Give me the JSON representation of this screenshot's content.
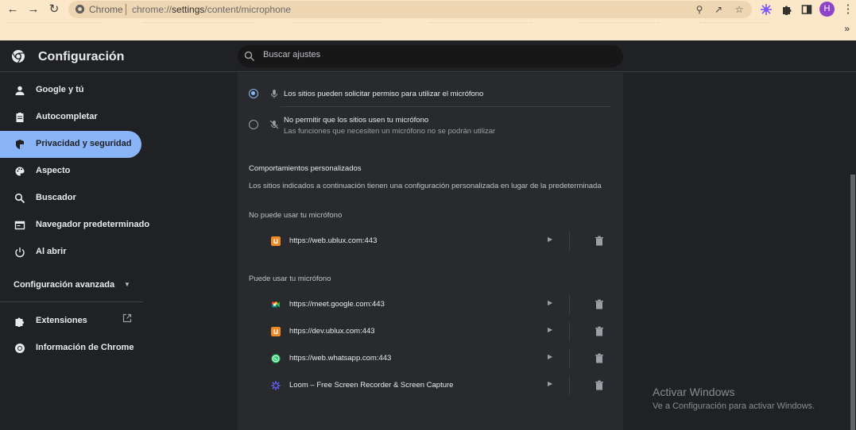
{
  "browser": {
    "site_label": "Chrome",
    "url_prefix": "chrome://",
    "url_host": "settings",
    "url_path": "/content/microphone",
    "profile_initial": "H",
    "icons": [
      "back-icon",
      "forward-icon",
      "reload-icon",
      "info-icon",
      "zoom-icon",
      "share-icon",
      "star-icon",
      "extension-icon",
      "puzzle-icon",
      "side-panel-icon",
      "menu-icon"
    ]
  },
  "header": {
    "title": "Configuración",
    "search_placeholder": "Buscar ajustes"
  },
  "sidebar": {
    "items": [
      {
        "label": "Google y tú",
        "icon": "person-icon"
      },
      {
        "label": "Autocompletar",
        "icon": "clipboard-icon"
      },
      {
        "label": "Privacidad y seguridad",
        "icon": "shield-icon",
        "active": true
      },
      {
        "label": "Aspecto",
        "icon": "palette-icon"
      },
      {
        "label": "Buscador",
        "icon": "search-icon"
      },
      {
        "label": "Navegador predeterminado",
        "icon": "browser-icon"
      },
      {
        "label": "Al abrir",
        "icon": "power-icon"
      }
    ],
    "advanced_label": "Configuración avanzada",
    "extensions_label": "Extensiones",
    "about_label": "Información de Chrome"
  },
  "content": {
    "option_allow_label": "Los sitios pueden solicitar permiso para utilizar el micrófono",
    "option_block_label": "No permitir que los sitios usen tu micrófono",
    "option_block_sub": "Las funciones que necesiten un micrófono no se podrán utilizar",
    "custom_title": "Comportamientos personalizados",
    "custom_desc": "Los sitios indicados a continuación tienen una configuración personalizada en lugar de la predeterminada",
    "blocked_title": "No puede usar tu micrófono",
    "blocked_sites": [
      {
        "url": "https://web.ublux.com:443",
        "icon": "ublux-icon",
        "color": "#f08a24"
      }
    ],
    "allowed_title": "Puede usar tu micrófono",
    "allowed_sites": [
      {
        "url": "https://meet.google.com:443",
        "icon": "google-meet-icon",
        "color": "#00897b"
      },
      {
        "url": "https://dev.ublux.com:443",
        "icon": "ublux-icon",
        "color": "#f08a24"
      },
      {
        "url": "https://web.whatsapp.com:443",
        "icon": "whatsapp-icon",
        "color": "#25d366"
      },
      {
        "url": "Loom – Free Screen Recorder & Screen Capture",
        "icon": "loom-icon",
        "color": "#625df5"
      }
    ]
  },
  "watermark": {
    "title": "Activar Windows",
    "subtitle": "Ve a Configuración para activar Windows."
  },
  "colors": {
    "accent": "#8ab4f8",
    "background": "#202124",
    "card": "#292a2d",
    "toolbar": "#fce8c8"
  }
}
